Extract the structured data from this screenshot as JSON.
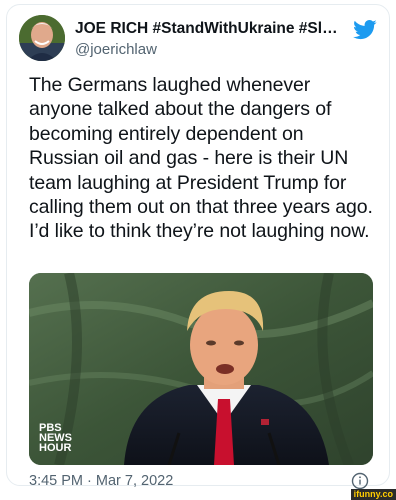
{
  "tweet": {
    "display_name": "JOE RICH #StandWithUkraine #SlavaU...",
    "handle": "@joerichlaw",
    "text": "The Germans laughed whenever anyone talked about the dangers of becoming entirely dependent on Russian oil and gas - here is their UN team laughing at President Trump for calling them out on that three years ago. I’d like to think they’re not laughing now.",
    "timestamp": "3:45 PM · Mar 7, 2022",
    "media_badge": [
      "PBS",
      "NEWS",
      "HOUR"
    ]
  },
  "icons": {
    "brand": "twitter-bird-icon",
    "info": "info-icon"
  },
  "colors": {
    "twitter_blue": "#1d9bf0",
    "secondary_text": "#536471",
    "primary_text": "#0f1419"
  },
  "watermark": "ifunny.co"
}
